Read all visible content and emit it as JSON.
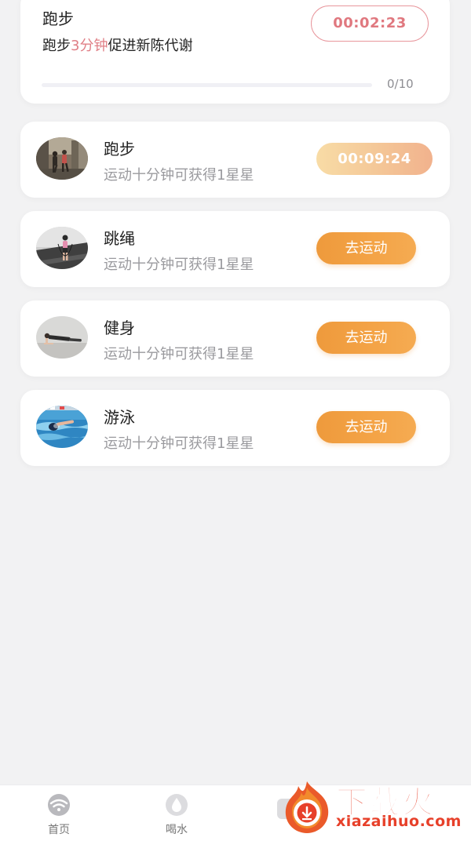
{
  "top_card": {
    "title": "跑步",
    "desc_prefix": "跑步",
    "desc_highlight": "3分钟",
    "desc_suffix": "促进新陈代谢",
    "timer": "00:02:23",
    "progress_text": "0/10",
    "progress_value": 0
  },
  "exercises": [
    {
      "title": "跑步",
      "subtitle": "运动十分钟可获得1星星",
      "action": "00:09:24",
      "thumb": "running-photo"
    },
    {
      "title": "跳绳",
      "subtitle": "运动十分钟可获得1星星",
      "action": "去运动",
      "thumb": "jump-rope-photo"
    },
    {
      "title": "健身",
      "subtitle": "运动十分钟可获得1星星",
      "action": "去运动",
      "thumb": "fitness-plank-photo"
    },
    {
      "title": "游泳",
      "subtitle": "运动十分钟可获得1星星",
      "action": "去运动",
      "thumb": "swimming-photo"
    }
  ],
  "nav": {
    "items": [
      {
        "label": "首页",
        "icon": "wifi-icon"
      },
      {
        "label": "喝水",
        "icon": "water-drop-icon"
      }
    ]
  },
  "watermark": {
    "name": "下载火",
    "url": "xiazaihuo.com"
  },
  "colors": {
    "accent_orange": "#f0a040",
    "highlight_pink": "#e07f86",
    "timer_gradient_start": "#f8dca6",
    "timer_gradient_end": "#f1b28d",
    "watermark_red": "#e7402a"
  }
}
